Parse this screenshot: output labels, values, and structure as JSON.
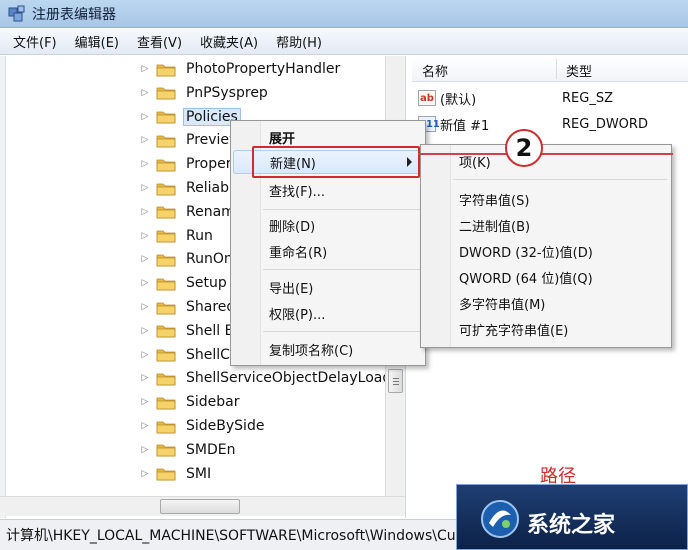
{
  "window": {
    "title": "注册表编辑器"
  },
  "menu": [
    "文件(F)",
    "编辑(E)",
    "查看(V)",
    "收藏夹(A)",
    "帮助(H)"
  ],
  "tree": {
    "items": [
      {
        "label": "PhotoPropertyHandler",
        "selected": false
      },
      {
        "label": "PnPSysprep",
        "selected": false
      },
      {
        "label": "Policies",
        "selected": true
      },
      {
        "label": "Preview",
        "selected": false
      },
      {
        "label": "Proper",
        "selected": false
      },
      {
        "label": "Reliabi",
        "selected": false
      },
      {
        "label": "Renam",
        "selected": false
      },
      {
        "label": "Run",
        "selected": false
      },
      {
        "label": "RunOn",
        "selected": false
      },
      {
        "label": "Setup",
        "selected": false
      },
      {
        "label": "Shared",
        "selected": false
      },
      {
        "label": "Shell E",
        "selected": false
      },
      {
        "label": "ShellCo",
        "selected": false
      },
      {
        "label": "ShellServiceObjectDelayLoad",
        "selected": false
      },
      {
        "label": "Sidebar",
        "selected": false
      },
      {
        "label": "SideBySide",
        "selected": false
      },
      {
        "label": "SMDEn",
        "selected": false
      },
      {
        "label": "SMI",
        "selected": false
      }
    ]
  },
  "values_pane": {
    "col_name": "名称",
    "col_type": "类型",
    "rows": [
      {
        "icon": "ab",
        "name": "(默认)",
        "type": "REG_SZ"
      },
      {
        "icon": "011",
        "name": "新值 #1",
        "type": "REG_DWORD"
      }
    ]
  },
  "context_menu": {
    "items": [
      "展开",
      "新建(N)",
      "查找(F)...",
      "删除(D)",
      "重命名(R)",
      "导出(E)",
      "权限(P)...",
      "复制项名称(C)"
    ]
  },
  "submenu": {
    "items": [
      "项(K)",
      "字符串值(S)",
      "二进制值(B)",
      "DWORD (32-位)值(D)",
      "QWORD (64 位)值(Q)",
      "多字符串值(M)",
      "可扩充字符串值(E)"
    ]
  },
  "annotation": {
    "step": "2",
    "partial_text": "路径"
  },
  "status": {
    "path": "计算机\\HKEY_LOCAL_MACHINE\\SOFTWARE\\Microsoft\\Windows\\Cu"
  },
  "watermark": {
    "text": "系统之家"
  },
  "colors": {
    "highlight_red": "#d12b2b",
    "titlebar": "#bcd6ef",
    "folder": "#e8b84a"
  }
}
